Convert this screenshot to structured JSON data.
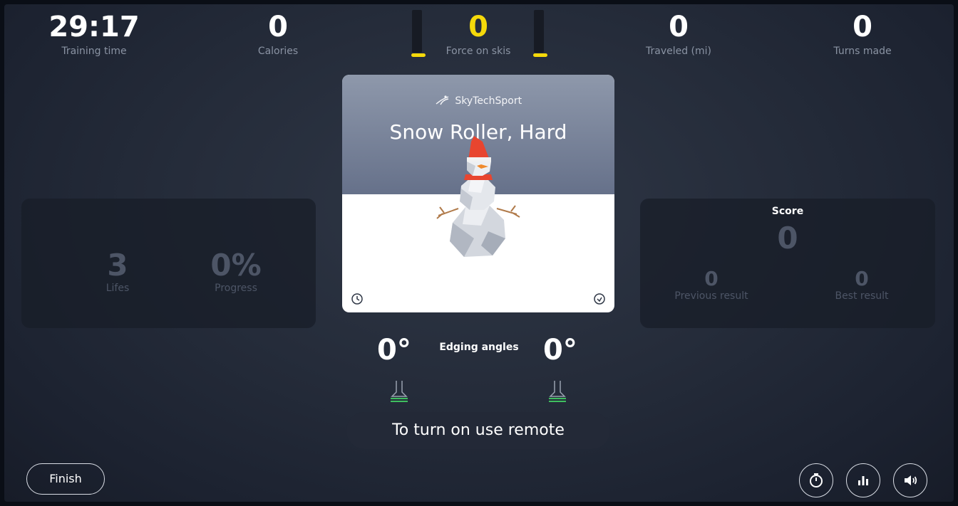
{
  "stats": {
    "training_time": {
      "value": "29:17",
      "label": "Training time"
    },
    "calories": {
      "value": "0",
      "label": "Calories"
    },
    "force": {
      "value": "0",
      "label": "Force on skis"
    },
    "traveled": {
      "value": "0",
      "label": "Traveled (mi)"
    },
    "turns": {
      "value": "0",
      "label": "Turns made"
    }
  },
  "left_panel": {
    "lifes": {
      "value": "3",
      "label": "Lifes"
    },
    "progress": {
      "value": "0%",
      "label": "Progress"
    }
  },
  "game_card": {
    "brand": "SkyTechSport",
    "title": "Snow Roller, Hard"
  },
  "score_panel": {
    "title": "Score",
    "score": "0",
    "previous": {
      "value": "0",
      "label": "Previous result"
    },
    "best": {
      "value": "0",
      "label": "Best result"
    }
  },
  "edging": {
    "left_angle": "0°",
    "right_angle": "0°",
    "label": "Edging angles"
  },
  "remote_message": "To turn on use remote",
  "finish_label": "Finish",
  "controls": {
    "timer_icon": "stopwatch-icon",
    "stats_icon": "bar-chart-icon",
    "sound_icon": "speaker-icon"
  },
  "colors": {
    "accent": "#f5d90a",
    "edging_indicator": "#3fbf5f"
  }
}
